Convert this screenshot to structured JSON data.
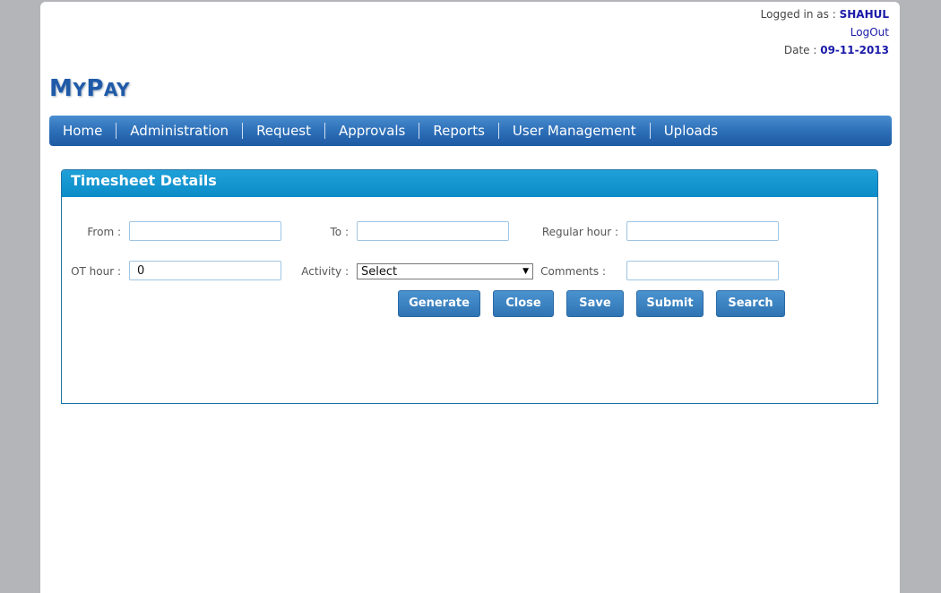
{
  "user": {
    "logged_in_label": "Logged in as :",
    "username": "SHAHUL",
    "logout": "LogOut",
    "date_label": "Date :",
    "date": "09-11-2013"
  },
  "logo": {
    "first_a": "M",
    "rest_a": "Y",
    "first_b": "P",
    "rest_b": "AY"
  },
  "nav": [
    "Home",
    "Administration",
    "Request",
    "Approvals",
    "Reports",
    "User Management",
    "Uploads"
  ],
  "panel": {
    "title": "Timesheet Details",
    "from_label": "From :",
    "from_value": "",
    "to_label": "To :",
    "to_value": "",
    "regular_label": "Regular hour :",
    "regular_value": "",
    "ot_label": "OT hour :",
    "ot_value": "0",
    "activity_label": "Activity :",
    "activity_value": "Select",
    "comments_label": "Comments :",
    "comments_value": ""
  },
  "buttons": {
    "generate": "Generate",
    "close": "Close",
    "save": "Save",
    "submit": "Submit",
    "search": "Search"
  }
}
